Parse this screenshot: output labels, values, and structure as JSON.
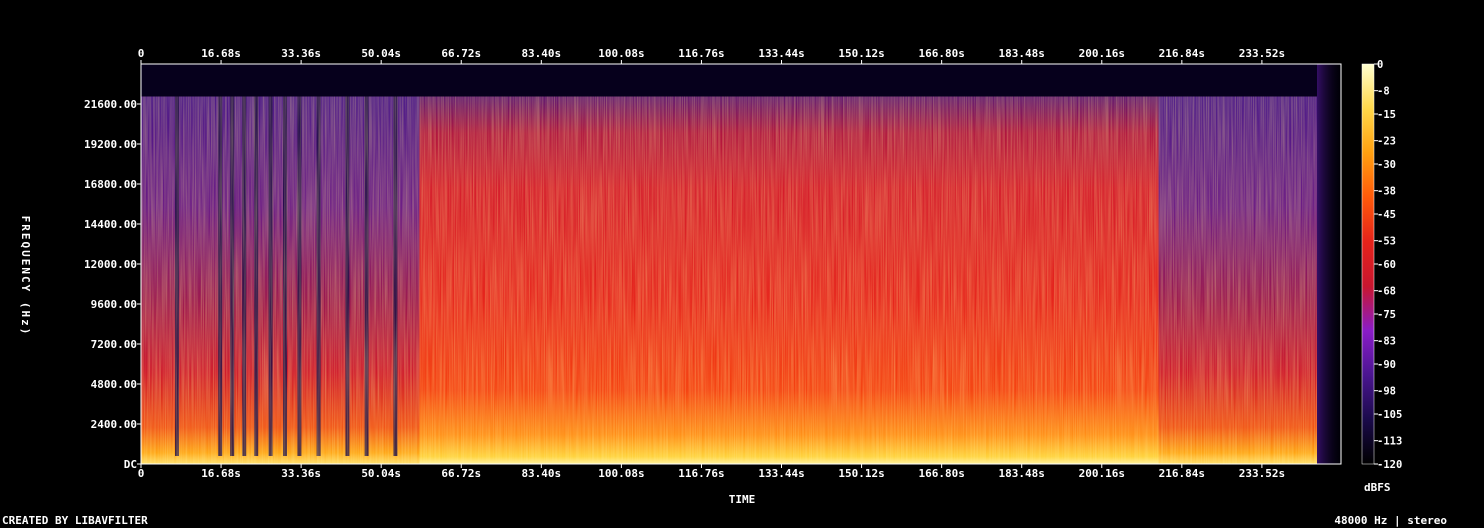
{
  "chart_data": {
    "type": "heatmap",
    "xlabel": "TIME",
    "ylabel": "FREQUENCY (Hz)",
    "colorbar_label": "dBFS",
    "x_ticks": [
      "0",
      "16.68s",
      "33.36s",
      "50.04s",
      "66.72s",
      "83.40s",
      "100.08s",
      "116.76s",
      "133.44s",
      "150.12s",
      "166.80s",
      "183.48s",
      "200.16s",
      "216.84s",
      "233.52s"
    ],
    "x_tick_values": [
      0,
      16.68,
      33.36,
      50.04,
      66.72,
      83.4,
      100.08,
      116.76,
      133.44,
      150.12,
      166.8,
      183.48,
      200.16,
      216.84,
      233.52
    ],
    "xlim": [
      0,
      250
    ],
    "y_ticks": [
      "DC",
      "2400.00",
      "4800.00",
      "7200.00",
      "9600.00",
      "12000.00",
      "14400.00",
      "16800.00",
      "19200.00",
      "21600.00"
    ],
    "y_tick_values": [
      0,
      2400,
      4800,
      7200,
      9600,
      12000,
      14400,
      16800,
      19200,
      21600
    ],
    "ylim": [
      0,
      24000
    ],
    "colorbar_ticks": [
      "0",
      "-8",
      "-15",
      "-23",
      "-30",
      "-38",
      "-45",
      "-53",
      "-60",
      "-68",
      "-75",
      "-83",
      "-90",
      "-98",
      "-105",
      "-113",
      "-120"
    ],
    "colorbar_values": [
      0,
      -8,
      -15,
      -23,
      -30,
      -38,
      -45,
      -53,
      -60,
      -68,
      -75,
      -83,
      -90,
      -98,
      -105,
      -113,
      -120
    ],
    "colorbar_range": [
      -120,
      0
    ],
    "colormap": [
      "#000000",
      "#1a0a4a",
      "#4a1590",
      "#8a1cc8",
      "#c8162f",
      "#e6231a",
      "#ff5a0a",
      "#ffa010",
      "#ffd84a",
      "#ffffd0"
    ],
    "audio_end_s": 245,
    "lowpass_cutoff_hz": 22050,
    "quiet_sections_s": [
      [
        0,
        58
      ],
      [
        212,
        245
      ]
    ],
    "dark_gaps_s": [
      7.5,
      16.5,
      19,
      21.5,
      24,
      27,
      30,
      33,
      37,
      43,
      47,
      53
    ]
  },
  "footer": {
    "credit": "CREATED BY LIBAVFILTER",
    "info": "48000 Hz | stereo"
  }
}
